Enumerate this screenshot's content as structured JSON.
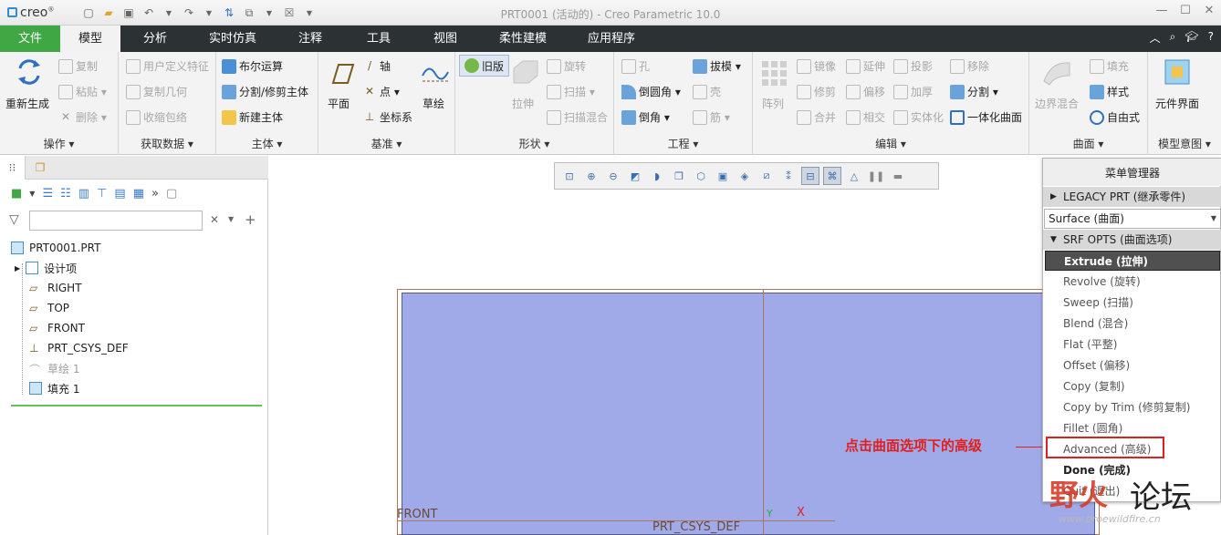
{
  "app": {
    "logo": "creo",
    "title": "PRT0001 (活动的) - Creo Parametric 10.0"
  },
  "tabs": [
    "文件",
    "模型",
    "分析",
    "实时仿真",
    "注释",
    "工具",
    "视图",
    "柔性建模",
    "应用程序"
  ],
  "ribbon": {
    "operations": {
      "label": "操作",
      "regen": "重新生成",
      "copy": "复制",
      "paste": "粘贴",
      "delete": "删除"
    },
    "get_data": {
      "label": "获取数据",
      "udf": "用户定义特征",
      "copy_geom": "复制几何",
      "shrinkwrap": "收缩包络"
    },
    "body": {
      "label": "主体",
      "boolean": "布尔运算",
      "split": "分割/修剪主体",
      "new_body": "新建主体"
    },
    "datum": {
      "label": "基准",
      "plane": "平面",
      "axis": "轴",
      "point": "点",
      "csys": "坐标系",
      "sketch": "草绘"
    },
    "shapes": {
      "label": "形状",
      "legacy": "旧版",
      "extrude": "拉伸",
      "revolve": "旋转",
      "sweep": "扫描",
      "swept_blend": "扫描混合"
    },
    "engineering": {
      "label": "工程",
      "hole": "孔",
      "round": "倒圆角",
      "chamfer": "倒角",
      "draft": "拔模",
      "shell": "壳",
      "rib": "筋"
    },
    "editing": {
      "label": "编辑",
      "pattern": "阵列",
      "mirror": "镜像",
      "extend": "延伸",
      "project": "投影",
      "trim": "修剪",
      "offset": "偏移",
      "thicken": "加厚",
      "merge": "合并",
      "intersect": "相交",
      "solidify": "实体化",
      "remove": "移除",
      "split": "分割",
      "unify": "一体化曲面"
    },
    "surfaces": {
      "label": "曲面",
      "boundary_blend": "边界混合",
      "fill": "填充",
      "style": "样式",
      "freestyle": "自由式"
    },
    "model_intent": {
      "label": "模型意图",
      "component_interface": "元件界面"
    }
  },
  "model_tree": {
    "root": "PRT0001.PRT",
    "items": [
      {
        "label": "设计项"
      },
      {
        "label": "RIGHT"
      },
      {
        "label": "TOP"
      },
      {
        "label": "FRONT"
      },
      {
        "label": "PRT_CSYS_DEF"
      },
      {
        "label": "草绘 1"
      },
      {
        "label": "填充 1"
      }
    ],
    "search_placeholder": ""
  },
  "graphics": {
    "front_label": "FRONT",
    "csys_label": "PRT_CSYS_DEF",
    "axis_x": "X",
    "axis_y": "Y"
  },
  "annotation": "点击曲面选项下的高级",
  "menu_manager": {
    "title": "菜单管理器",
    "legacy": "LEGACY PRT (继承零件)",
    "selection": "Surface (曲面)",
    "srf_opts": "SRF OPTS (曲面选项)",
    "items": [
      "Extrude (拉伸)",
      "Revolve (旋转)",
      "Sweep (扫描)",
      "Blend (混合)",
      "Flat (平整)",
      "Offset (偏移)",
      "Copy (复制)",
      "Copy by Trim (修剪复制)",
      "Fillet (圆角)",
      "Advanced (高级)"
    ],
    "done": "Done (完成)",
    "quit": "Quit (退出)"
  },
  "watermark": {
    "part1": "野火",
    "part2": "论坛",
    "url": "www.proewildfire.cn"
  },
  "colors": {
    "file_tab": "#3fa844",
    "surface": "#a0aae8",
    "annotation": "#e02020"
  }
}
